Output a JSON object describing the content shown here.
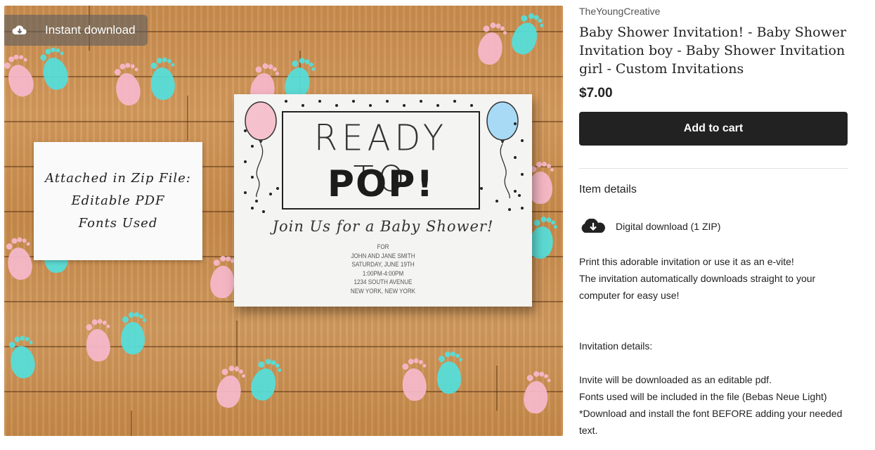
{
  "image": {
    "badge": {
      "label": "Instant download",
      "icon": "cloud-download-icon"
    },
    "note_card": {
      "lines": [
        "Attached in Zip File:",
        "Editable PDF",
        "Fonts Used"
      ]
    },
    "invite": {
      "line1": "READY TO",
      "line2": "POP!",
      "script": "Join Us for a Baby Shower!",
      "details": [
        "FOR",
        "JOHN AND JANE SMITH",
        "SATURDAY, JUNE 19TH",
        "1:00PM-4:00PM",
        "1234 SOUTH AVENUE",
        "NEW YORK, NEW YORK"
      ],
      "balloon_colors": {
        "left": "#f5c1cc",
        "right": "#a8daf5"
      }
    },
    "foot_colors": {
      "pink": "#f6b8cc",
      "blue": "#52e0dc"
    }
  },
  "listing": {
    "shop_name": "TheYoungCreative",
    "title": "Baby Shower Invitation! - Baby Shower Invitation boy - Baby Shower Invitation girl - Custom Invitations",
    "price": "$7.00",
    "add_to_cart_label": "Add to cart",
    "item_details_heading": "Item details",
    "download": {
      "icon": "cloud-download-icon",
      "label": "Digital download (1 ZIP)"
    },
    "description": {
      "p1": "Print this adorable invitation or use it as an e-vite!",
      "p2": "The invitation automatically downloads straight to your computer for easy use!",
      "p3": "Invitation details:",
      "p4": "Invite will be downloaded as an editable pdf.",
      "p5": "Fonts used will be included in the file (Bebas Neue Light)",
      "p6": "*Download and install the font BEFORE adding your needed text."
    }
  }
}
